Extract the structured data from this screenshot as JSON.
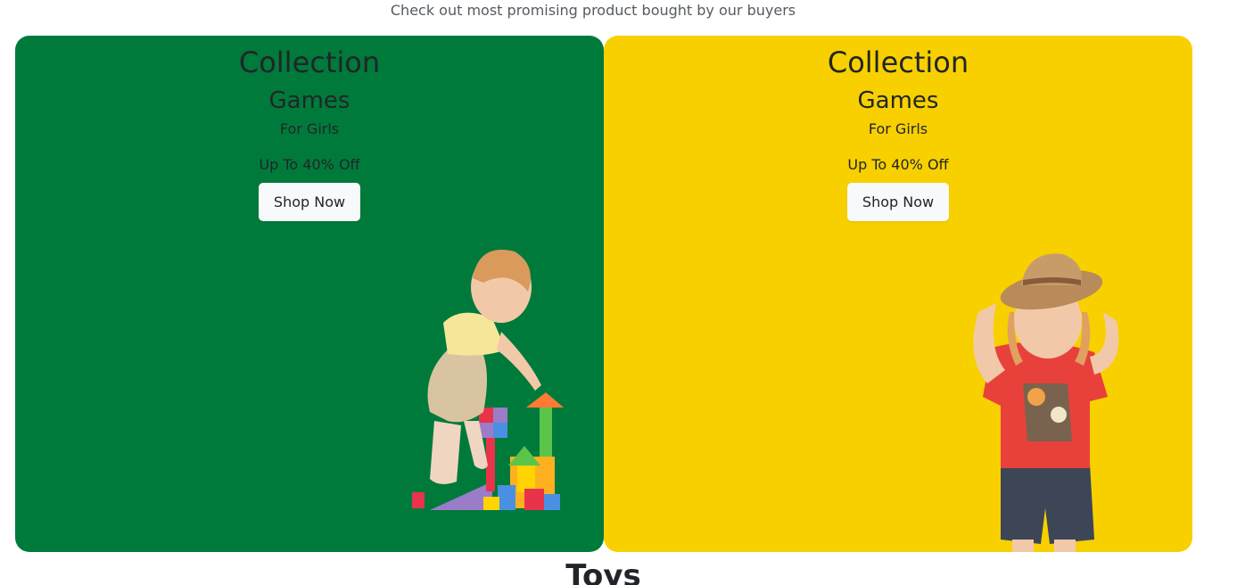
{
  "header": {
    "subtitle": "Check out most promising product bought by our buyers"
  },
  "cards": [
    {
      "title": "Collection",
      "subtitle": "Games",
      "tag": "For Girls",
      "offer": "Up To 40% Off",
      "button_label": "Shop Now",
      "background": "#007a3b",
      "illustration": "child-building-blocks"
    },
    {
      "title": "Collection",
      "subtitle": "Games",
      "tag": "For Girls",
      "offer": "Up To 40% Off",
      "button_label": "Shop Now",
      "background": "#f8d000",
      "illustration": "child-with-straw-hat"
    }
  ],
  "next_section": {
    "heading": "Toys"
  }
}
